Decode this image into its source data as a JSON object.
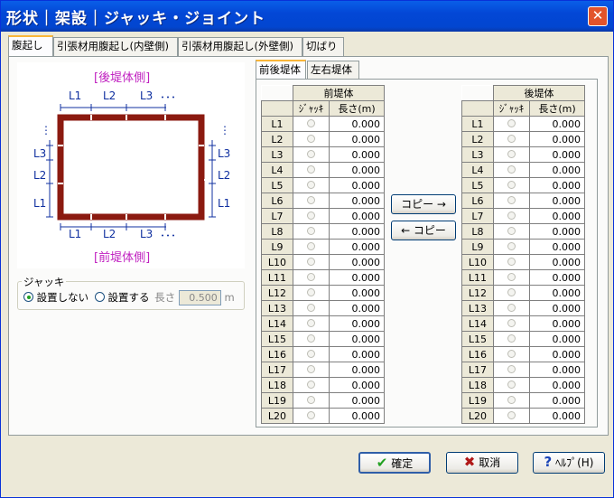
{
  "window": {
    "title": "形状｜架設｜ジャッキ・ジョイント",
    "close_label": "✕"
  },
  "tabs": [
    "腹起し",
    "引張材用腹起し(内壁側)",
    "引張材用腹起し(外壁側)",
    "切ばり"
  ],
  "diagram": {
    "top_label": "[後堤体側]",
    "bottom_label": "[前堤体側]",
    "top_marks": [
      "L1",
      "L2",
      "L3",
      "･･･"
    ],
    "bottom_marks": [
      "L1",
      "L2",
      "L3",
      "･･･"
    ],
    "left_marks": [
      "L3",
      "L2",
      "L1"
    ],
    "right_marks": [
      "L3",
      "L2",
      "L1"
    ],
    "dots": "⋮"
  },
  "jack": {
    "legend": "ジャッキ",
    "opt1": "設置しない",
    "opt2": "設置する",
    "length_label": "長さ",
    "length_value": "0.500",
    "unit": "m",
    "selected": "opt1"
  },
  "subtabs": [
    "前後堤体",
    "左右堤体"
  ],
  "front_table": {
    "title": "前堤体",
    "col_jack": "ｼﾞｬｯｷ",
    "col_len": "長さ(m)"
  },
  "back_table": {
    "title": "後堤体",
    "col_jack": "ｼﾞｬｯｷ",
    "col_len": "長さ(m)"
  },
  "rows": [
    {
      "label": "L1",
      "front": "0.000",
      "back": "0.000"
    },
    {
      "label": "L2",
      "front": "0.000",
      "back": "0.000"
    },
    {
      "label": "L3",
      "front": "0.000",
      "back": "0.000"
    },
    {
      "label": "L4",
      "front": "0.000",
      "back": "0.000"
    },
    {
      "label": "L5",
      "front": "0.000",
      "back": "0.000"
    },
    {
      "label": "L6",
      "front": "0.000",
      "back": "0.000"
    },
    {
      "label": "L7",
      "front": "0.000",
      "back": "0.000"
    },
    {
      "label": "L8",
      "front": "0.000",
      "back": "0.000"
    },
    {
      "label": "L9",
      "front": "0.000",
      "back": "0.000"
    },
    {
      "label": "L10",
      "front": "0.000",
      "back": "0.000"
    },
    {
      "label": "L11",
      "front": "0.000",
      "back": "0.000"
    },
    {
      "label": "L12",
      "front": "0.000",
      "back": "0.000"
    },
    {
      "label": "L13",
      "front": "0.000",
      "back": "0.000"
    },
    {
      "label": "L14",
      "front": "0.000",
      "back": "0.000"
    },
    {
      "label": "L15",
      "front": "0.000",
      "back": "0.000"
    },
    {
      "label": "L16",
      "front": "0.000",
      "back": "0.000"
    },
    {
      "label": "L17",
      "front": "0.000",
      "back": "0.000"
    },
    {
      "label": "L18",
      "front": "0.000",
      "back": "0.000"
    },
    {
      "label": "L19",
      "front": "0.000",
      "back": "0.000"
    },
    {
      "label": "L20",
      "front": "0.000",
      "back": "0.000"
    }
  ],
  "copy_right": "コピー →",
  "copy_left": "← コピー",
  "buttons": {
    "ok": "確定",
    "cancel": "取消",
    "help": "ﾍﾙﾌﾟ(H)"
  },
  "colors": {
    "frame": "#8b1a10",
    "title_bar": "#0347d6",
    "label_magenta": "#c020c0",
    "dim_blue": "#1030a0"
  }
}
